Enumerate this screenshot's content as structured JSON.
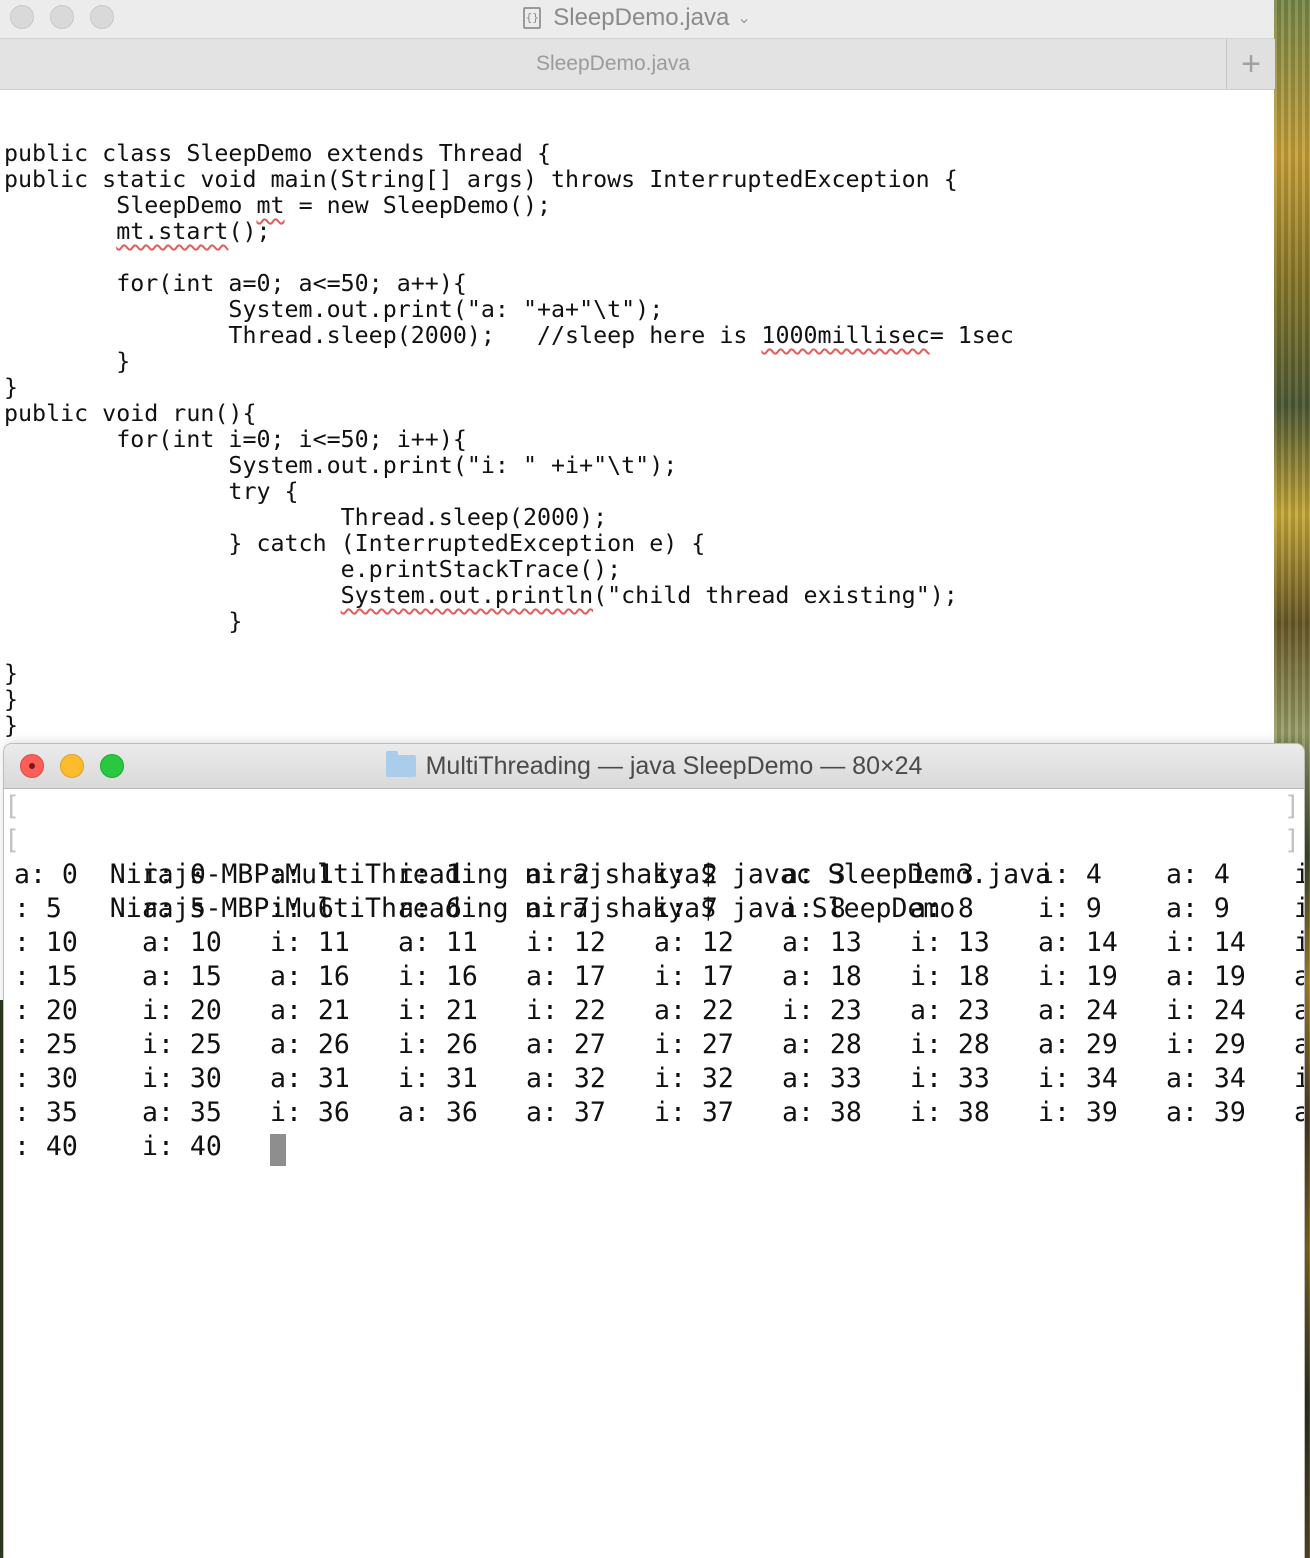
{
  "editor": {
    "window_title": "SleepDemo.java",
    "tab_label": "SleepDemo.java",
    "add_tab_symbol": "+",
    "code_lines": [
      "",
      "public class SleepDemo extends Thread {",
      "public static void main(String[] args) throws InterruptedException {",
      "\tSleepDemo mt = new SleepDemo();",
      "\tmt.start();",
      "",
      "\tfor(int a=0; a<=50; a++){",
      "\t\tSystem.out.print(\"a: \"+a+\"\\t\");",
      "\t\tThread.sleep(2000);   //sleep here is 1000millisec= 1sec",
      "\t}",
      "}",
      "public void run(){",
      "\tfor(int i=0; i<=50; i++){",
      "\t\tSystem.out.print(\"i: \" +i+\"\\t\");",
      "\t\ttry {",
      "\t\t\tThread.sleep(2000);",
      "\t\t} catch (InterruptedException e) {",
      "\t\t\te.printStackTrace();",
      "\t\t\tSystem.out.println(\"child thread existing\");",
      "\t\t}",
      "",
      "}",
      "}",
      "}"
    ]
  },
  "terminal": {
    "window_title": "MultiThreading — java SleepDemo — 80×24",
    "commands": [
      "Nirajs-MBP:MultiThreading nirajshakya$ javac SleepDemo.java",
      "Nirajs-MBP:MultiThreading nirajshakya$ java SleepDemo"
    ],
    "output_rows": [
      [
        "a: 0",
        "i: 0",
        "a: 1",
        "i: 1",
        "a: 2",
        "i: 2",
        "a: 3",
        "i: 3",
        "i: 4",
        "a: 4",
        "i"
      ],
      [
        ": 5",
        "a: 5",
        "i: 6",
        "a: 6",
        "a: 7",
        "i: 7",
        "i: 8",
        "a: 8",
        "i: 9",
        "a: 9",
        "i"
      ],
      [
        ": 10",
        "a: 10",
        "i: 11",
        "a: 11",
        "i: 12",
        "a: 12",
        "a: 13",
        "i: 13",
        "a: 14",
        "i: 14",
        "i"
      ],
      [
        ": 15",
        "a: 15",
        "a: 16",
        "i: 16",
        "a: 17",
        "i: 17",
        "a: 18",
        "i: 18",
        "i: 19",
        "a: 19",
        "a"
      ],
      [
        ": 20",
        "i: 20",
        "a: 21",
        "i: 21",
        "i: 22",
        "a: 22",
        "i: 23",
        "a: 23",
        "a: 24",
        "i: 24",
        "a"
      ],
      [
        ": 25",
        "i: 25",
        "a: 26",
        "i: 26",
        "a: 27",
        "i: 27",
        "a: 28",
        "i: 28",
        "a: 29",
        "i: 29",
        "a"
      ],
      [
        ": 30",
        "i: 30",
        "a: 31",
        "i: 31",
        "a: 32",
        "i: 32",
        "a: 33",
        "i: 33",
        "i: 34",
        "a: 34",
        "i"
      ],
      [
        ": 35",
        "a: 35",
        "i: 36",
        "a: 36",
        "a: 37",
        "i: 37",
        "a: 38",
        "i: 38",
        "i: 39",
        "a: 39",
        "a"
      ],
      [
        ": 40",
        "i: 40"
      ]
    ]
  },
  "colors": {
    "spellcheck_underline": "#e35c5c",
    "close_button": "#fc5f57",
    "minimize_button": "#fdbc2e",
    "zoom_button": "#28c840"
  }
}
